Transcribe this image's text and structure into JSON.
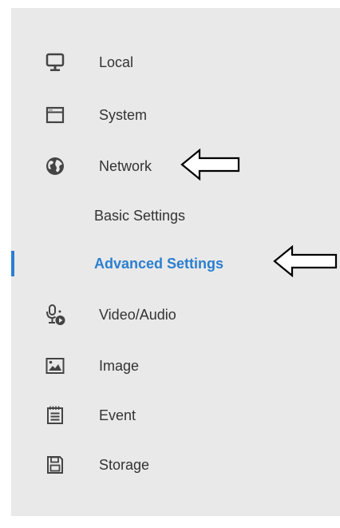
{
  "menu": {
    "items": [
      {
        "label": "Local",
        "icon": "monitor-icon"
      },
      {
        "label": "System",
        "icon": "window-icon"
      },
      {
        "label": "Network",
        "icon": "globe-icon"
      },
      {
        "label": "Basic Settings"
      },
      {
        "label": "Advanced Settings",
        "active": true
      },
      {
        "label": "Video/Audio",
        "icon": "microphone-play-icon"
      },
      {
        "label": "Image",
        "icon": "picture-icon"
      },
      {
        "label": "Event",
        "icon": "calendar-list-icon"
      },
      {
        "label": "Storage",
        "icon": "floppy-disk-icon"
      }
    ]
  },
  "colors": {
    "panel_background": "#e9e9e9",
    "text": "#333333",
    "active": "#2b7fcf",
    "icon": "#444444"
  }
}
